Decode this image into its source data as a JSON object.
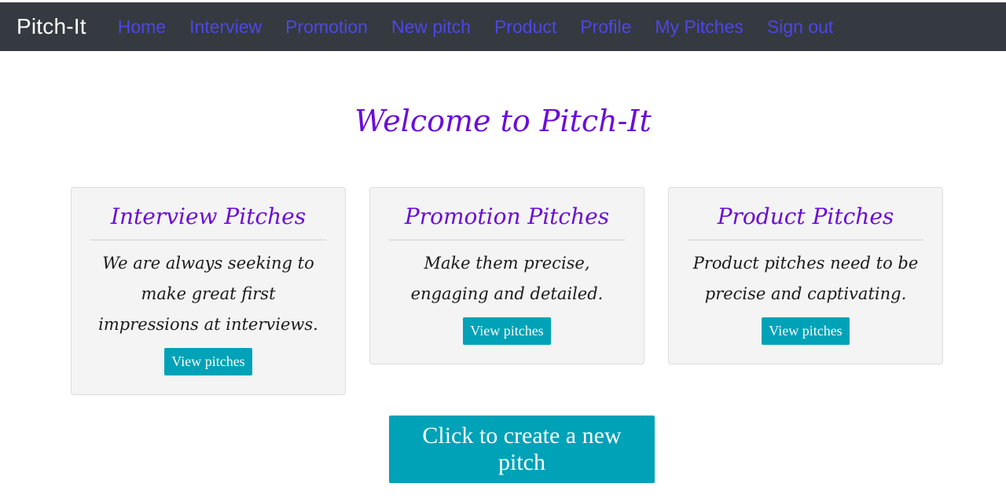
{
  "navbar": {
    "brand": "Pitch-It",
    "links": [
      "Home",
      "Interview",
      "Promotion",
      "New pitch",
      "Product",
      "Profile",
      "My Pitches",
      "Sign out"
    ]
  },
  "main": {
    "title": "Welcome to Pitch-It",
    "cards": [
      {
        "title": "Interview Pitches",
        "text": "We are always seeking to make great first impressions at interviews.",
        "button": "View pitches"
      },
      {
        "title": "Promotion Pitches",
        "text": "Make them precise, engaging and detailed.",
        "button": "View pitches"
      },
      {
        "title": "Product Pitches",
        "text": "Product pitches need to be precise and captivating.",
        "button": "View pitches"
      }
    ],
    "create_button": "Click to create a new pitch"
  },
  "colors": {
    "navbar_bg": "#343a40",
    "nav_link": "#4f46e5",
    "heading": "#6a0dd8",
    "button_bg": "#00a2b8",
    "card_bg": "#f4f4f4"
  }
}
